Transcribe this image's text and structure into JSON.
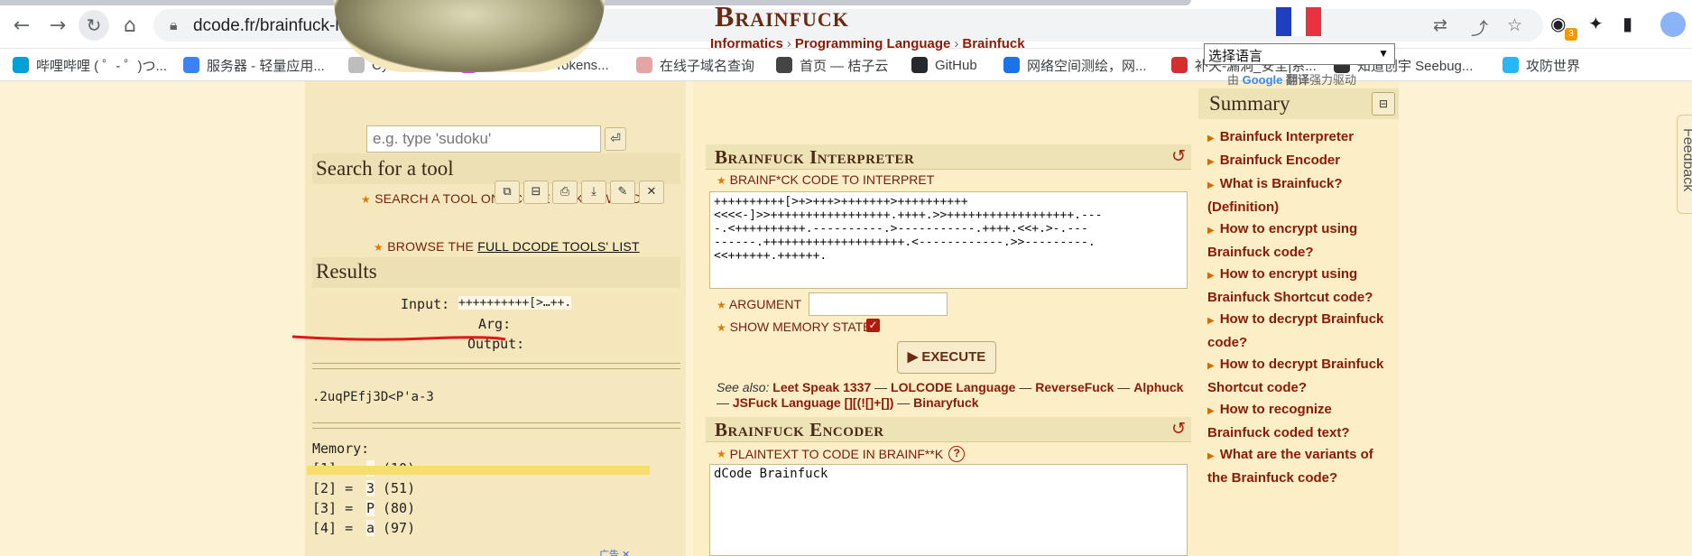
{
  "browser": {
    "url": "dcode.fr/brainfuck-language",
    "extension_badge": "3",
    "bookmarks": [
      {
        "label": "哔哩哔哩 ( ゜- ゜)つ...",
        "color": "#00a1d6"
      },
      {
        "label": "服务器 - 轻量应用...",
        "color": "#3b82f6"
      },
      {
        "label": "CyberChef",
        "color": "#bdbdbd"
      },
      {
        "label": "JSON Web Tokens...",
        "color": "#d63aff"
      },
      {
        "label": "在线子域名查询",
        "color": "#e4a5a5"
      },
      {
        "label": "首页 — 桔子云",
        "color": "#444444"
      },
      {
        "label": "GitHub",
        "color": "#24292e"
      },
      {
        "label": "网络空间测绘，网...",
        "color": "#1a73e8"
      },
      {
        "label": "补天-漏洞_安全|系...",
        "color": "#d32f2f"
      },
      {
        "label": "知道创宇 Seebug...",
        "color": "#333333"
      },
      {
        "label": "攻防世界",
        "color": "#29b6f6"
      }
    ]
  },
  "left": {
    "search_title": "Search for a tool",
    "search_keywords_label": "SEARCH A TOOL ON DCODE BY KEYWORDS:",
    "search_placeholder": "e.g. type 'sudoku'",
    "browse_prefix": "BROWSE THE ",
    "browse_link": "FULL DCODE TOOLS' LIST",
    "results_title": "Results",
    "input_label": "Input:",
    "input_value": "++++++++++[>…++.",
    "arg_label": "Arg:",
    "output_label": "Output:",
    "output_value": ".2uqPEfj3D<P'a-3",
    "memory_label": "Memory:",
    "memory": [
      {
        "idx": "[1] =",
        "char": " ",
        "code": "(10)"
      },
      {
        "idx": "[2] =",
        "char": "3",
        "code": "(51)"
      },
      {
        "idx": "[3] =",
        "char": "P",
        "code": "(80)"
      },
      {
        "idx": "[4] =",
        "char": "a",
        "code": "(97)"
      }
    ],
    "ad_label": "广告"
  },
  "main": {
    "title": "Brainfuck",
    "breadcrumbs": [
      "Informatics",
      "Programming Language",
      "Brainfuck"
    ],
    "interpreter_title": "Brainfuck Interpreter",
    "code_label": "BRAINF*CK CODE TO INTERPRET",
    "code_value": "++++++++++[>+>+++>+++++++>++++++++++\n<<<<-]>>+++++++++++++++++.++++.>>++++++++++++++++++.---\n-.<++++++++++.----------.>-----------.++++.<<+.>-.---\n------.++++++++++++++++++++.<------------.>>---------.\n<<++++++.++++++.",
    "argument_label": "ARGUMENT",
    "show_memory_label": "SHOW MEMORY STATE",
    "execute_label": "EXECUTE",
    "see_also_label": "See also:",
    "see_also": [
      "Leet Speak 1337",
      "LOLCODE Language",
      "ReverseFuck",
      "Alphuck",
      "JSFuck Language [][(![]+[])",
      "Binaryfuck"
    ],
    "encoder_title": "Brainfuck Encoder",
    "plaintext_label": "PLAINTEXT TO CODE IN BRAINF**K",
    "plaintext_value": "dCode Brainfuck"
  },
  "right": {
    "lang_select": "选择语言",
    "google_prefix": "由 ",
    "google_word": "Google",
    "google_suffix_bold": " 翻译",
    "google_suffix": "强力驱动",
    "summary_title": "Summary",
    "summary_items": [
      "Brainfuck Interpreter",
      "Brainfuck Encoder",
      "What is Brainfuck? (Definition)",
      "How to encrypt using Brainfuck code?",
      "How to encrypt using Brainfuck Shortcut code?",
      "How to decrypt Brainfuck code?",
      "How to decrypt Brainfuck Shortcut code?",
      "How to recognize Brainfuck coded text?",
      "What are the variants of the Brainfuck code?"
    ],
    "feedback_label": "Feedback"
  },
  "colors": {
    "accent": "#8b1a06",
    "page_bg": "#fdf3d4",
    "flag_blue": "#1f3fbf",
    "flag_white": "#ffffff",
    "flag_red": "#e8323e"
  }
}
